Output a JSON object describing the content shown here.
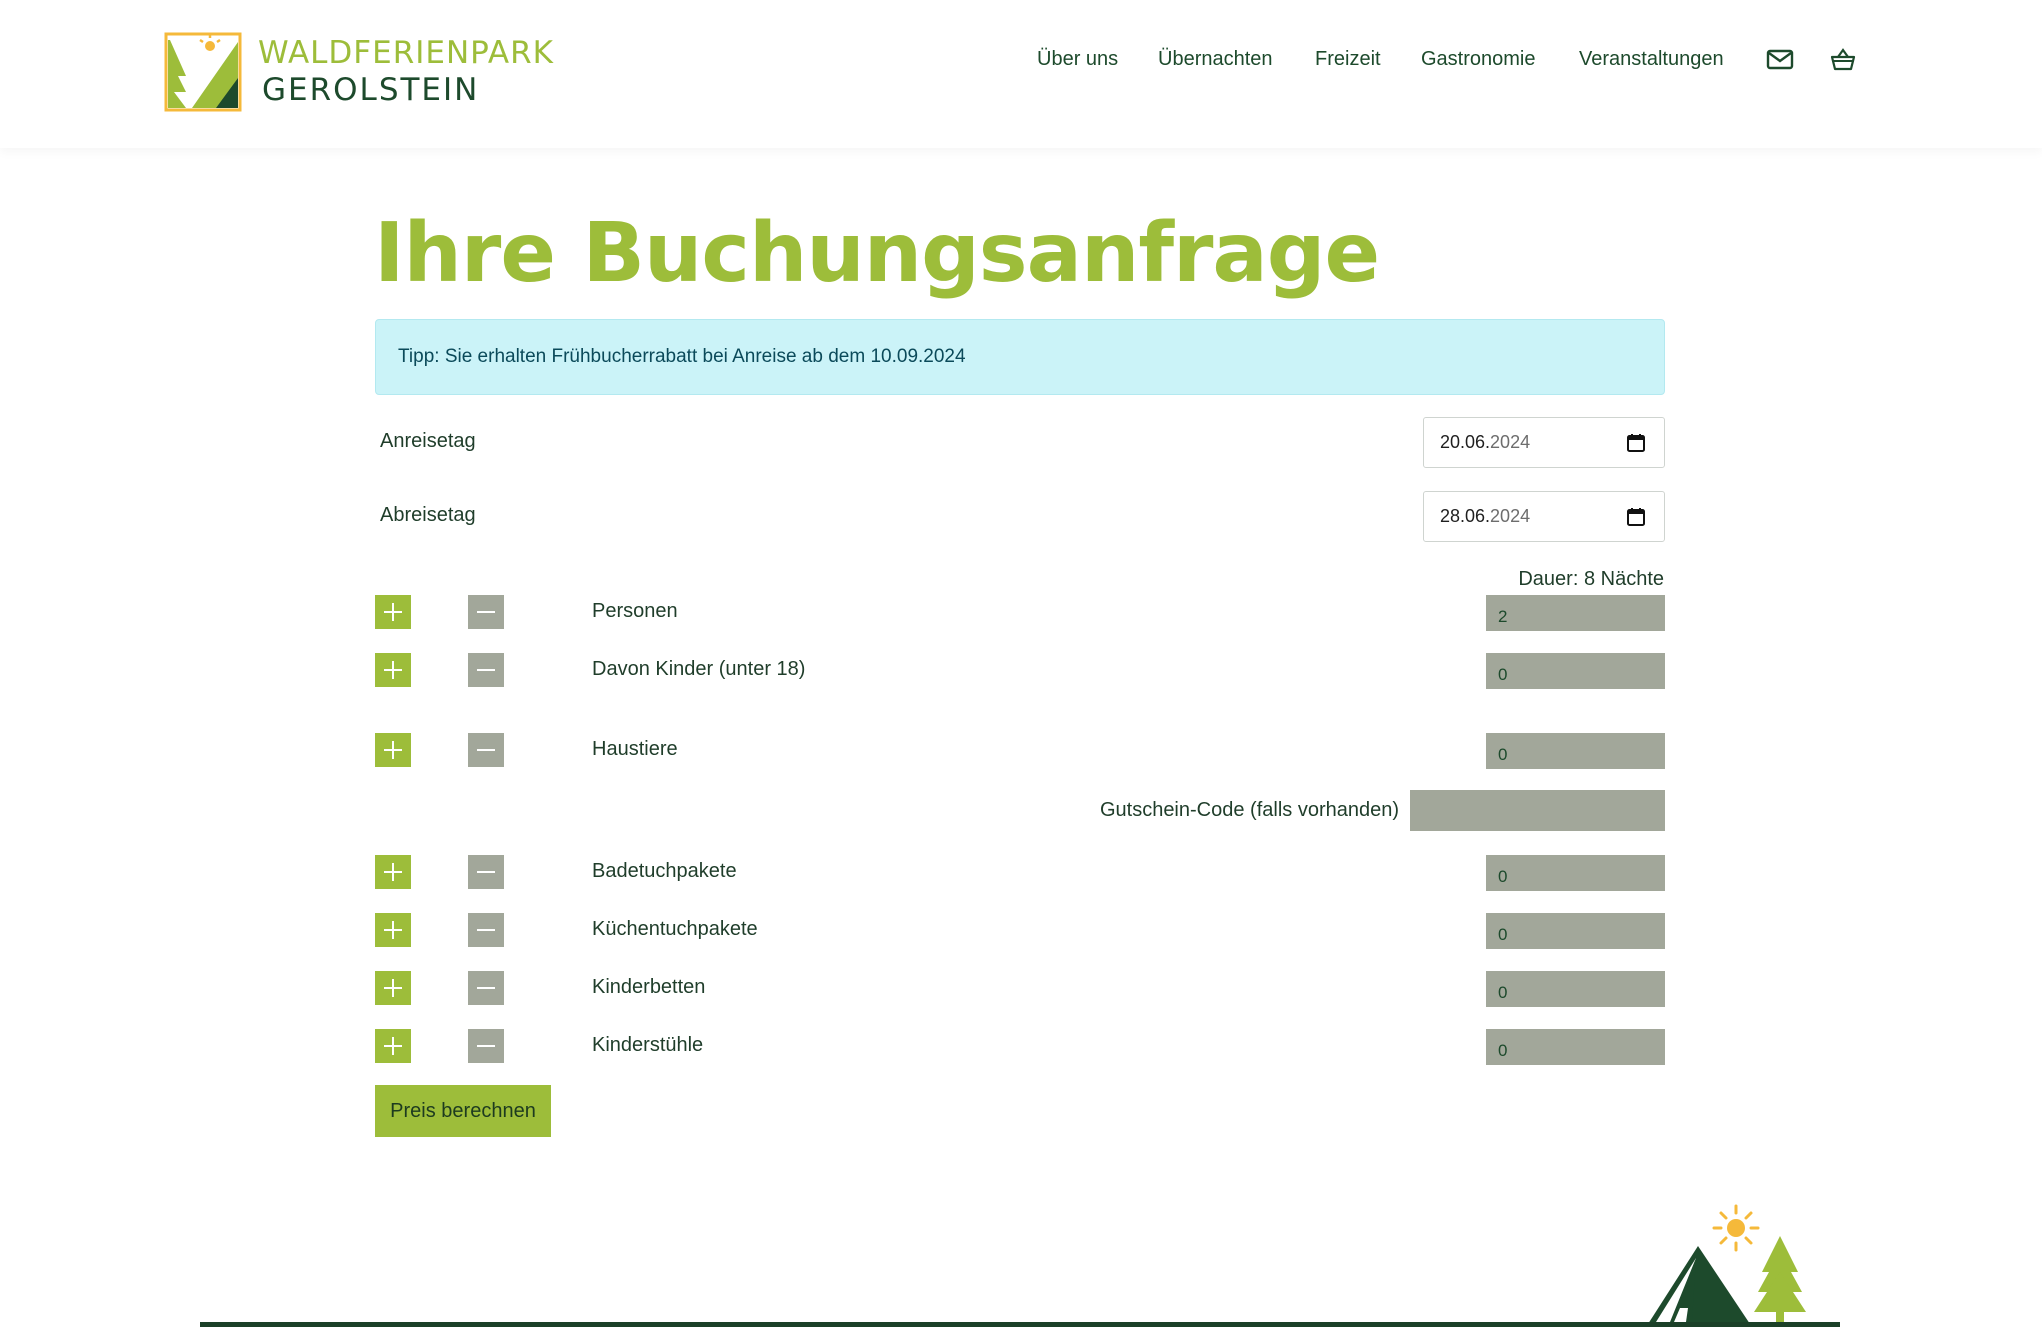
{
  "header": {
    "logo": {
      "line1": "WALDFERIENPARK",
      "line2": "GEROLSTEIN"
    },
    "nav": [
      {
        "label": "Über uns"
      },
      {
        "label": "Übernachten"
      },
      {
        "label": "Freizeit"
      },
      {
        "label": "Gastronomie"
      },
      {
        "label": "Veranstaltungen"
      }
    ],
    "icons": {
      "mail": "mail-icon",
      "cart": "basket-icon"
    }
  },
  "page": {
    "title": "Ihre Buchungsanfrage",
    "tip": "Tipp: Sie erhalten Frühbucherrabatt bei Anreise ab dem 10.09.2024"
  },
  "form": {
    "arrival": {
      "label": "Anreisetag",
      "day_month": "20.06.",
      "year": "2024"
    },
    "departure": {
      "label": "Abreisetag",
      "day_month": "28.06.",
      "year": "2024"
    },
    "duration": "Dauer: 8 Nächte",
    "counters": [
      {
        "label": "Personen",
        "value": "2"
      },
      {
        "label": "Davon Kinder (unter 18)",
        "value": "0"
      },
      {
        "label": "Haustiere",
        "value": "0"
      },
      {
        "label": "Badetuchpakete",
        "value": "0"
      },
      {
        "label": "Küchentuchpakete",
        "value": "0"
      },
      {
        "label": "Kinderbetten",
        "value": "0"
      },
      {
        "label": "Kinderstühle",
        "value": "0"
      }
    ],
    "voucher": {
      "label": "Gutschein-Code (falls vorhanden)",
      "value": ""
    },
    "submit_label": "Preis berechnen"
  },
  "colors": {
    "brand_green": "#9dbd3a",
    "dark_green": "#1d4a2c",
    "field_grey": "#a2a79a",
    "tip_bg": "#cbf3f8",
    "sun_yellow": "#f5b93a"
  }
}
